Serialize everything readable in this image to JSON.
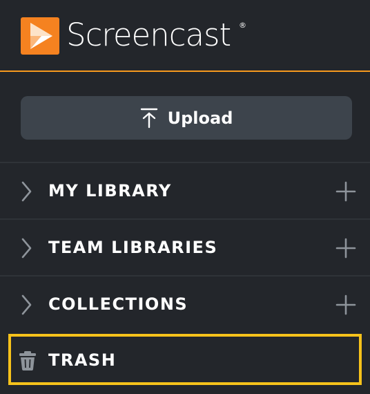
{
  "brand": {
    "name": "Screencast",
    "registered_mark": "®",
    "accent_color": "#f58220",
    "divider_color": "#f79a1e"
  },
  "upload": {
    "label": "Upload",
    "icon": "upload-icon"
  },
  "nav": {
    "items": [
      {
        "label": "MY LIBRARY",
        "icon": "chevron-right-icon",
        "action_icon": "plus-icon"
      },
      {
        "label": "TEAM LIBRARIES",
        "icon": "chevron-right-icon",
        "action_icon": "plus-icon"
      },
      {
        "label": "COLLECTIONS",
        "icon": "chevron-right-icon",
        "action_icon": "plus-icon"
      }
    ],
    "trash": {
      "label": "TRASH",
      "icon": "trash-icon",
      "highlight_color": "#f6c21b"
    }
  },
  "colors": {
    "background": "#23262b",
    "button": "#3d444c",
    "row_divider": "#2f3338",
    "icon_muted": "#8e949b"
  }
}
